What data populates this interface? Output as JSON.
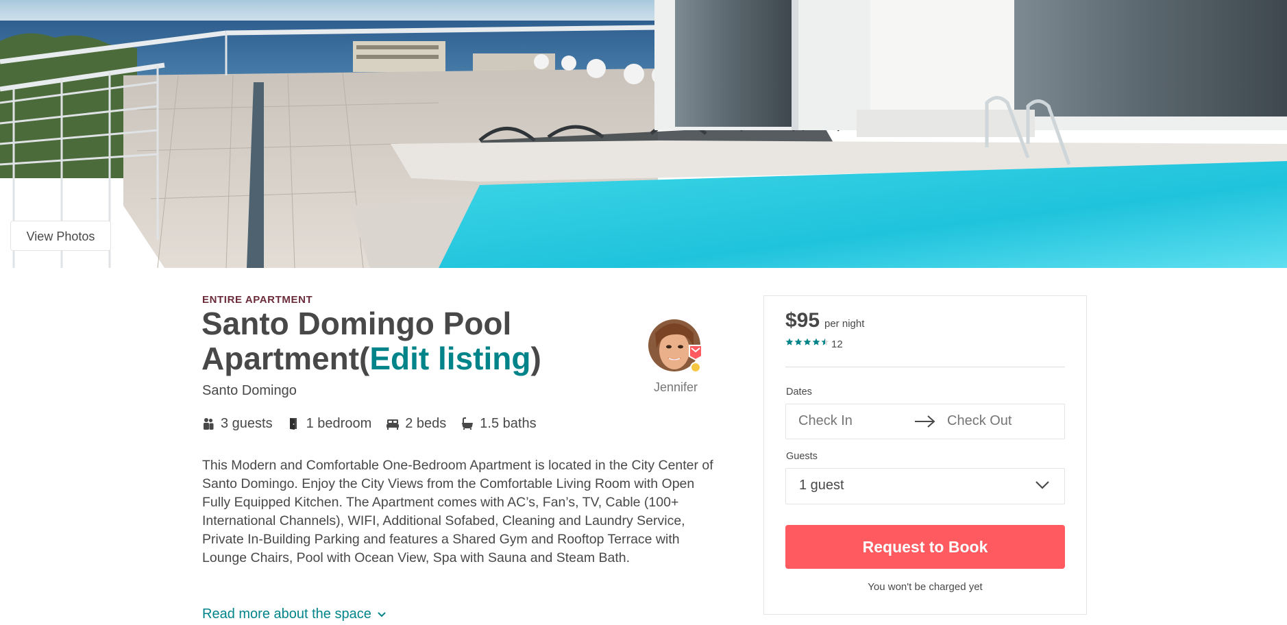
{
  "hero": {
    "view_photos_label": "View Photos"
  },
  "listing": {
    "kind": "ENTIRE APARTMENT",
    "title_line1": "Santo Domingo Pool",
    "title_line2_pre": "Apartment(",
    "edit_link": "Edit listing",
    "title_line2_post": ")",
    "city": "Santo Domingo",
    "stats": {
      "guests": "3 guests",
      "bedrooms": "1 bedroom",
      "beds": "2 beds",
      "baths": "1.5 baths"
    },
    "description": "This Modern and Comfortable One-Bedroom Apartment is located in the City Center of Santo Domingo. Enjoy the City Views from the Comfortable Living Room with Open Fully Equipped Kitchen. The Apartment comes with AC’s, Fan’s, TV, Cable (100+ International Channels), WIFI, Additional Sofabed, Cleaning and Laundry Service, Private In-Building Parking and features a Shared Gym and Rooftop Terrace with Lounge Chairs, Pool with Ocean View, Spa with Sauna and Steam Bath.",
    "read_more": "Read more about the space"
  },
  "host": {
    "name": "Jennifer",
    "badge": "superhost-medal-icon"
  },
  "booking": {
    "price": "$95",
    "per_night": "per night",
    "rating": 4.5,
    "reviews_count": "12",
    "dates_label": "Dates",
    "check_in_placeholder": "Check In",
    "check_out_placeholder": "Check Out",
    "guests_label": "Guests",
    "guests_value": "1 guest",
    "cta": "Request to Book",
    "note": "You won't be charged yet"
  },
  "colors": {
    "accent": "#008489",
    "cta": "#ff5a5f",
    "text": "#484848",
    "kind": "#6b2b3a"
  },
  "icons": [
    "guests-icon",
    "door-icon",
    "bed-icon",
    "bath-icon",
    "chevron-down-icon",
    "arrow-right-icon",
    "star-icon"
  ]
}
